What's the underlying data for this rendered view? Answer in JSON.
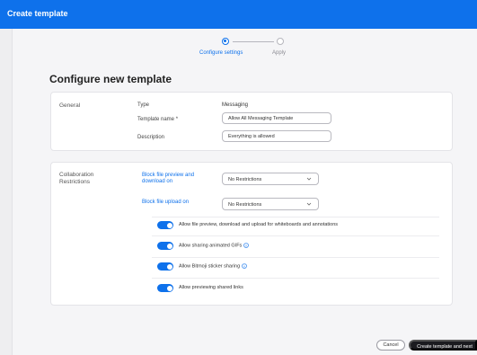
{
  "window": {
    "title": "Create template"
  },
  "stepper": {
    "steps": [
      {
        "label": "Configure settings",
        "state": "active"
      },
      {
        "label": "Apply",
        "state": "pending"
      }
    ]
  },
  "page": {
    "heading": "Configure new template"
  },
  "general": {
    "section_label": "General",
    "type_label": "Type",
    "type_value": "Messaging",
    "name_label": "Template name *",
    "name_value": "Allow All Messaging Template",
    "description_label": "Description",
    "description_value": "Everything is allowed"
  },
  "collaboration": {
    "section_label": "Collaboration Restrictions",
    "block_preview_label": "Block file preview and download on",
    "block_preview_value": "No Restrictions",
    "block_upload_label": "Block file upload on",
    "block_upload_value": "No Restrictions",
    "toggles": [
      {
        "label": "Allow file preview, download and upload for whiteboards and annotations",
        "on": true,
        "info": false
      },
      {
        "label": "Allow sharing animated GIFs",
        "on": true,
        "info": true
      },
      {
        "label": "Allow Bitmoji sticker sharing",
        "on": true,
        "info": true
      },
      {
        "label": "Allow previewing shared links",
        "on": true,
        "info": false
      }
    ]
  },
  "footer": {
    "cancel_label": "Cancel",
    "next_label": "Create template and next"
  },
  "colors": {
    "accent": "#0e71eb",
    "titlebar": "#0e71eb",
    "primary_button": "#1b1b1f"
  }
}
